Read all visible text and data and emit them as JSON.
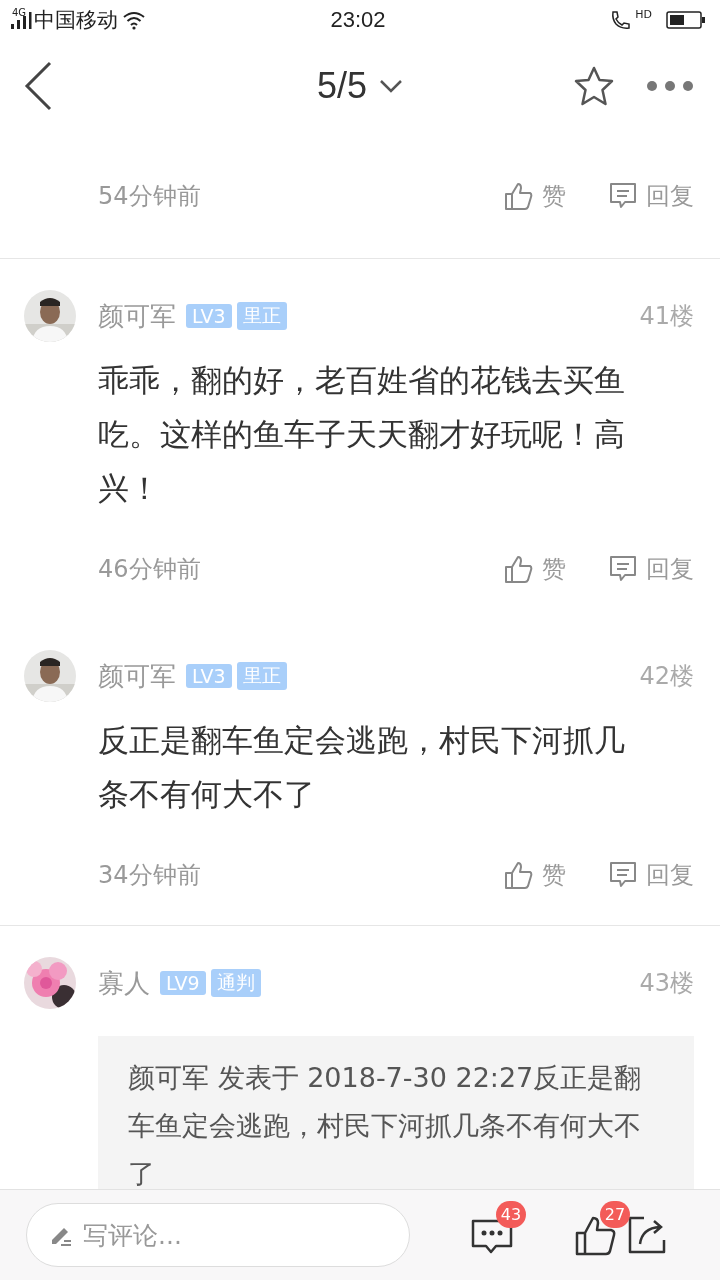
{
  "status_bar": {
    "network": "4G",
    "carrier": "中国移动",
    "time": "23:02",
    "call_label": "HD"
  },
  "nav": {
    "page": "5/5"
  },
  "previous_comment": {
    "time": "54分钟前",
    "like_label": "赞",
    "reply_label": "回复"
  },
  "comments": [
    {
      "name": "颜可军",
      "level": "LV3",
      "title": "里正",
      "floor": "41楼",
      "text": "乖乖，翻的好，老百姓省的花钱去买鱼吃。这样的鱼车子天天翻才好玩呢！高兴！",
      "time": "46分钟前",
      "like_label": "赞",
      "reply_label": "回复",
      "divider": false
    },
    {
      "name": "颜可军",
      "level": "LV3",
      "title": "里正",
      "floor": "42楼",
      "text": "反正是翻车鱼定会逃跑，村民下河抓几条不有何大不了",
      "time": "34分钟前",
      "like_label": "赞",
      "reply_label": "回复",
      "divider": true
    },
    {
      "name": "寡人",
      "level": "LV9",
      "title": "通判",
      "floor": "43楼",
      "quote": "颜可军 发表于 2018-7-30 22:27反正是翻车鱼定会逃跑，村民下河抓几条不有何大不了"
    }
  ],
  "bottom_bar": {
    "placeholder": "写评论...",
    "comment_count": "43",
    "like_count": "27"
  }
}
